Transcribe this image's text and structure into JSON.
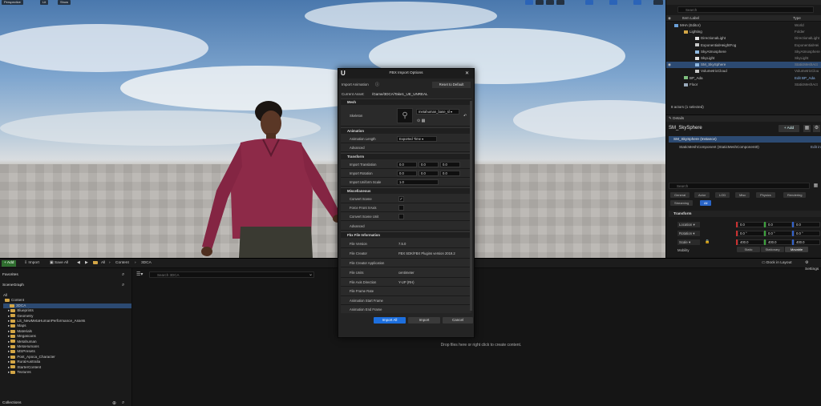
{
  "viewport": {
    "toolbar": {
      "perspective": "Perspective",
      "lit": "Lit",
      "show": "Show"
    }
  },
  "outliner": {
    "search_placeholder": "Search",
    "col_label": "Item Label",
    "col_type": "Type",
    "rows": [
      {
        "label": "MHA (Editor)",
        "type": "World"
      },
      {
        "label": "Lighting",
        "type": "Folder"
      },
      {
        "label": "DirectionalLight",
        "type": "DirectionalLight"
      },
      {
        "label": "ExponentialHeightFog",
        "type": "ExponentialHei"
      },
      {
        "label": "SkyAtmosphere",
        "type": "SkyAtmosphere"
      },
      {
        "label": "SkyLight",
        "type": "SkyLight"
      },
      {
        "label": "SM_SkySphere",
        "type": "StaticMeshAct"
      },
      {
        "label": "VolumetricCloud",
        "type": "VolumetricClou"
      },
      {
        "label": "BP_Ada",
        "type": "Edit BP_Ada"
      },
      {
        "label": "Floor",
        "type": "StaticMeshAct"
      }
    ],
    "status": "8 actors (1 selected)"
  },
  "details": {
    "tab_title": "Details",
    "object_name": "SM_SkySphere",
    "add_label": "+ Add",
    "instance_label": "SM_SkySphere (Instance)",
    "component_label": "StaticMeshComponent (StaticMeshComponent0)",
    "edit_in": "Edit in",
    "search_placeholder": "Search",
    "filters": [
      "General",
      "Actor",
      "LOD",
      "Misc",
      "Physics",
      "Rendering",
      "Streaming",
      "All"
    ],
    "transform_title": "Transform",
    "location_label": "Location",
    "rotation_label": "Rotation",
    "scale_label": "Scale",
    "location": [
      "0.0",
      "0.0",
      "0.0"
    ],
    "rotation": [
      "0.0 °",
      "0.0 °",
      "0.0 °"
    ],
    "scale": [
      "400.0",
      "400.0",
      "400.0"
    ],
    "mobility_label": "Mobility",
    "mobility_options": [
      "Static",
      "Stationary",
      "Movable"
    ]
  },
  "content_browser": {
    "add_label": "Add",
    "import_label": "Import",
    "save_all_label": "Save All",
    "path": [
      "All",
      "Content",
      "3DCA"
    ],
    "dock_label": "Dock in Layout",
    "settings_label": "Settings",
    "favorites_label": "Favorites",
    "scenegraph_label": "SceneGraph",
    "collections_label": "Collections",
    "search_placeholder": "Search 3DCA",
    "drop_hint": "Drop files here or right click to create content.",
    "tree": [
      "All",
      "Content",
      "3DCA",
      "Blueprints",
      "Geometry",
      "LS_NewMetaHumanPerformance_Assets",
      "Maps",
      "Materials",
      "Megascans",
      "Metahuman",
      "MetaHumans",
      "MSPresets",
      "Post_Apoca_Character",
      "RuralAustralia",
      "StarterContent",
      "Textures"
    ]
  },
  "dialog": {
    "title": "FBX Import Options",
    "import_animation_label": "Import Animation",
    "reset_label": "Reset to Default",
    "current_asset_label": "Current Asset:",
    "current_asset_value": "/Game/3DCA/Take1_UE_UNREAL",
    "mesh_section": "Mesh",
    "skeleton_label": "Skeleton",
    "skeleton_value": "metahuman_base_sl",
    "animation_section": "Animation",
    "animation_length_label": "Animation Length",
    "animation_length_value": "Exported Time",
    "advanced_label": "Advanced",
    "transform_section": "Transform",
    "import_translation_label": "Import Translation",
    "import_rotation_label": "Import Rotation",
    "import_uniform_scale_label": "Import Uniform Scale",
    "translation": [
      "0.0",
      "0.0",
      "0.0"
    ],
    "rotation": [
      "0.0",
      "0.0",
      "0.0"
    ],
    "uniform_scale": "1.0",
    "misc_section": "Miscellaneous",
    "convert_scene_label": "Convert Scene",
    "force_front_label": "Force Front XAxis",
    "convert_scene_unit_label": "Convert Scene Unit",
    "convert_scene_checked": true,
    "advanced2_label": "Advanced",
    "fbx_info_section": "Fbx File Information",
    "file_version_label": "File Version",
    "file_version_value": "7.5.0",
    "file_creator_label": "File Creator",
    "file_creator_value": "FBX SDK/FBX Plugins version 2019.2",
    "file_creator_app_label": "File Creator Application",
    "file_units_label": "File Units",
    "file_units_value": "centimeter",
    "file_axis_label": "File Axis Direction",
    "file_axis_value": "Y-UP (RH)",
    "file_frame_rate_label": "File Frame Rate",
    "anim_start_label": "Animation Start Frame",
    "anim_end_label": "Animation End Frame",
    "import_all_label": "Import All",
    "import_label": "Import",
    "cancel_label": "Cancel"
  }
}
